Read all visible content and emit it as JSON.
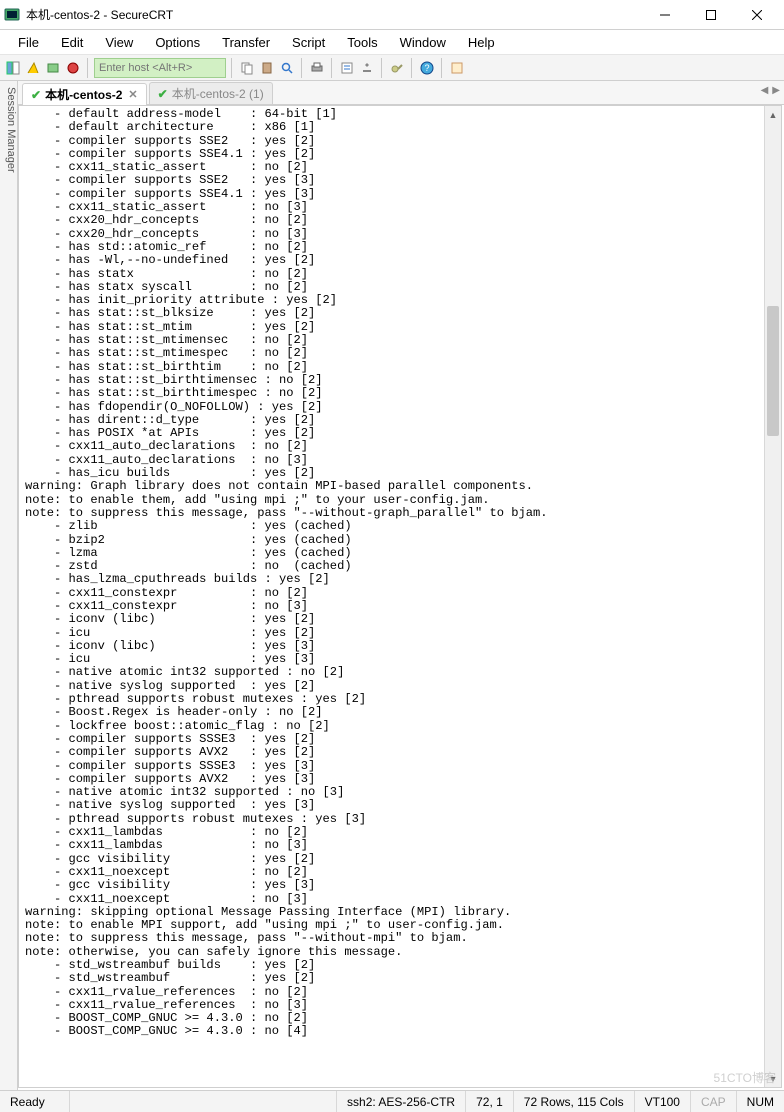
{
  "window": {
    "title": "本机-centos-2 - SecureCRT"
  },
  "menu": {
    "file": "File",
    "edit": "Edit",
    "view": "View",
    "options": "Options",
    "transfer": "Transfer",
    "script": "Script",
    "tools": "Tools",
    "window": "Window",
    "help": "Help"
  },
  "toolbar": {
    "host_placeholder": "Enter host <Alt+R>"
  },
  "session_manager_label": "Session Manager",
  "tabs": {
    "t0": {
      "label": "本机-centos-2"
    },
    "t1": {
      "label": "本机-centos-2 (1)"
    }
  },
  "terminal_lines": [
    "    - default address-model    : 64-bit [1]",
    "    - default architecture     : x86 [1]",
    "    - compiler supports SSE2   : yes [2]",
    "    - compiler supports SSE4.1 : yes [2]",
    "    - cxx11_static_assert      : no [2]",
    "    - compiler supports SSE2   : yes [3]",
    "    - compiler supports SSE4.1 : yes [3]",
    "    - cxx11_static_assert      : no [3]",
    "    - cxx20_hdr_concepts       : no [2]",
    "    - cxx20_hdr_concepts       : no [3]",
    "    - has std::atomic_ref      : no [2]",
    "    - has -Wl,--no-undefined   : yes [2]",
    "    - has statx                : no [2]",
    "    - has statx syscall        : no [2]",
    "    - has init_priority attribute : yes [2]",
    "    - has stat::st_blksize     : yes [2]",
    "    - has stat::st_mtim        : yes [2]",
    "    - has stat::st_mtimensec   : no [2]",
    "    - has stat::st_mtimespec   : no [2]",
    "    - has stat::st_birthtim    : no [2]",
    "    - has stat::st_birthtimensec : no [2]",
    "    - has stat::st_birthtimespec : no [2]",
    "    - has fdopendir(O_NOFOLLOW) : yes [2]",
    "    - has dirent::d_type       : yes [2]",
    "    - has POSIX *at APIs       : yes [2]",
    "    - cxx11_auto_declarations  : no [2]",
    "    - cxx11_auto_declarations  : no [3]",
    "    - has_icu builds           : yes [2]",
    "warning: Graph library does not contain MPI-based parallel components.",
    "note: to enable them, add \"using mpi ;\" to your user-config.jam.",
    "note: to suppress this message, pass \"--without-graph_parallel\" to bjam.",
    "    - zlib                     : yes (cached)",
    "    - bzip2                    : yes (cached)",
    "    - lzma                     : yes (cached)",
    "    - zstd                     : no  (cached)",
    "    - has_lzma_cputhreads builds : yes [2]",
    "    - cxx11_constexpr          : no [2]",
    "    - cxx11_constexpr          : no [3]",
    "    - iconv (libc)             : yes [2]",
    "    - icu                      : yes [2]",
    "    - iconv (libc)             : yes [3]",
    "    - icu                      : yes [3]",
    "    - native atomic int32 supported : no [2]",
    "    - native syslog supported  : yes [2]",
    "    - pthread supports robust mutexes : yes [2]",
    "    - Boost.Regex is header-only : no [2]",
    "    - lockfree boost::atomic_flag : no [2]",
    "    - compiler supports SSSE3  : yes [2]",
    "    - compiler supports AVX2   : yes [2]",
    "    - compiler supports SSSE3  : yes [3]",
    "    - compiler supports AVX2   : yes [3]",
    "    - native atomic int32 supported : no [3]",
    "    - native syslog supported  : yes [3]",
    "    - pthread supports robust mutexes : yes [3]",
    "    - cxx11_lambdas            : no [2]",
    "    - cxx11_lambdas            : no [3]",
    "    - gcc visibility           : yes [2]",
    "    - cxx11_noexcept           : no [2]",
    "    - gcc visibility           : yes [3]",
    "    - cxx11_noexcept           : no [3]",
    "warning: skipping optional Message Passing Interface (MPI) library.",
    "note: to enable MPI support, add \"using mpi ;\" to user-config.jam.",
    "note: to suppress this message, pass \"--without-mpi\" to bjam.",
    "note: otherwise, you can safely ignore this message.",
    "    - std_wstreambuf builds    : yes [2]",
    "    - std_wstreambuf           : yes [2]",
    "    - cxx11_rvalue_references  : no [2]",
    "    - cxx11_rvalue_references  : no [3]",
    "    - BOOST_COMP_GNUC >= 4.3.0 : no [2]",
    "    - BOOST_COMP_GNUC >= 4.3.0 : no [4]"
  ],
  "status": {
    "ready": "Ready",
    "cipher": "ssh2: AES-256-CTR",
    "cursor": "72,   1",
    "size": "72 Rows, 115 Cols",
    "term": "VT100",
    "cap": "CAP",
    "num": "NUM"
  },
  "watermark": "51CTO博客"
}
